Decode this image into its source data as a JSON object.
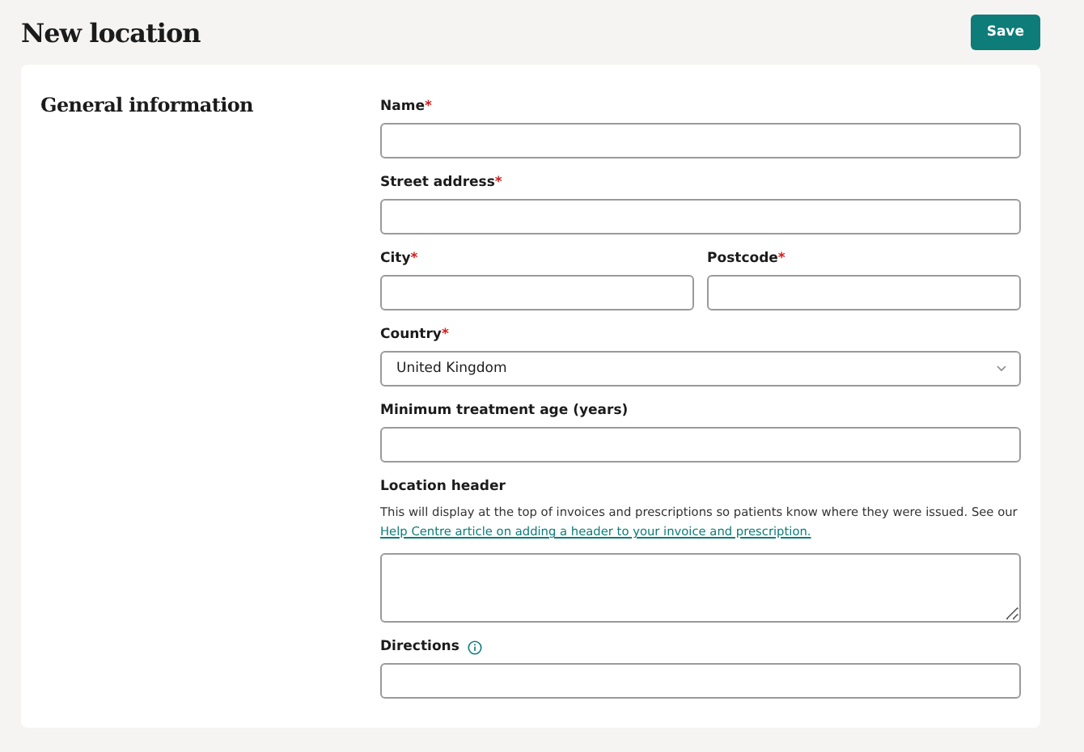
{
  "page": {
    "title": "New location",
    "save_button": "Save"
  },
  "section": {
    "title": "General information"
  },
  "required_marker": "*",
  "fields": [
    {
      "kind": "text",
      "label": "Name",
      "required": true
    },
    {
      "kind": "text",
      "label": "Street address",
      "required": true
    },
    {
      "kind": "pair",
      "fields": [
        {
          "label": "City",
          "required": true
        },
        {
          "label": "Postcode",
          "required": true
        }
      ]
    },
    {
      "kind": "select",
      "label": "Country",
      "required": true,
      "value": "United Kingdom"
    },
    {
      "kind": "text",
      "label": "Minimum treatment age (years)",
      "required": false
    },
    {
      "kind": "textarea",
      "label": "Location header",
      "required": false,
      "description": "This will display at the top of invoices and prescriptions so patients know where they were issued. See our",
      "link": "Help Centre article on adding a header to your invoice and prescription."
    },
    {
      "kind": "text",
      "label": "Directions",
      "required": false,
      "info": true
    }
  ]
}
